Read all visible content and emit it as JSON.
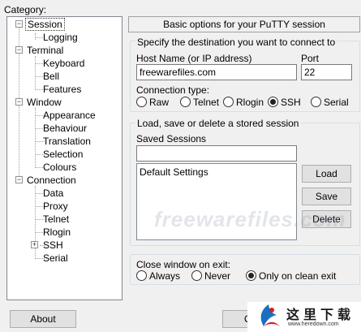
{
  "category_label": "Category:",
  "tree": {
    "session": "Session",
    "logging": "Logging",
    "terminal": "Terminal",
    "keyboard": "Keyboard",
    "bell": "Bell",
    "features": "Features",
    "window": "Window",
    "appearance": "Appearance",
    "behaviour": "Behaviour",
    "translation": "Translation",
    "selection": "Selection",
    "colours": "Colours",
    "connection": "Connection",
    "data": "Data",
    "proxy": "Proxy",
    "telnet": "Telnet",
    "rlogin": "Rlogin",
    "ssh": "SSH",
    "serial": "Serial"
  },
  "panel_title": "Basic options for your PuTTY session",
  "destination": {
    "group_label": "Specify the destination you want to connect to",
    "host_label": "Host Name (or IP address)",
    "host_value": "freewarefiles.com",
    "port_label": "Port",
    "port_value": "22",
    "conn_type_label": "Connection type:",
    "types": {
      "raw": "Raw",
      "telnet": "Telnet",
      "rlogin": "Rlogin",
      "ssh": "SSH",
      "serial": "Serial"
    },
    "selected": "SSH"
  },
  "sessions": {
    "group_label": "Load, save or delete a stored session",
    "saved_label": "Saved Sessions",
    "saved_value": "",
    "list_items": [
      "Default Settings"
    ],
    "load": "Load",
    "save": "Save",
    "delete": "Delete"
  },
  "close_window": {
    "label": "Close window on exit:",
    "always": "Always",
    "never": "Never",
    "clean": "Only on clean exit",
    "selected": "Only on clean exit"
  },
  "watermark": "freewarefiles.com",
  "bottom": {
    "about": "About",
    "open": "Op"
  },
  "logo": {
    "text": "这里下载",
    "url": "www.heredown.com"
  }
}
